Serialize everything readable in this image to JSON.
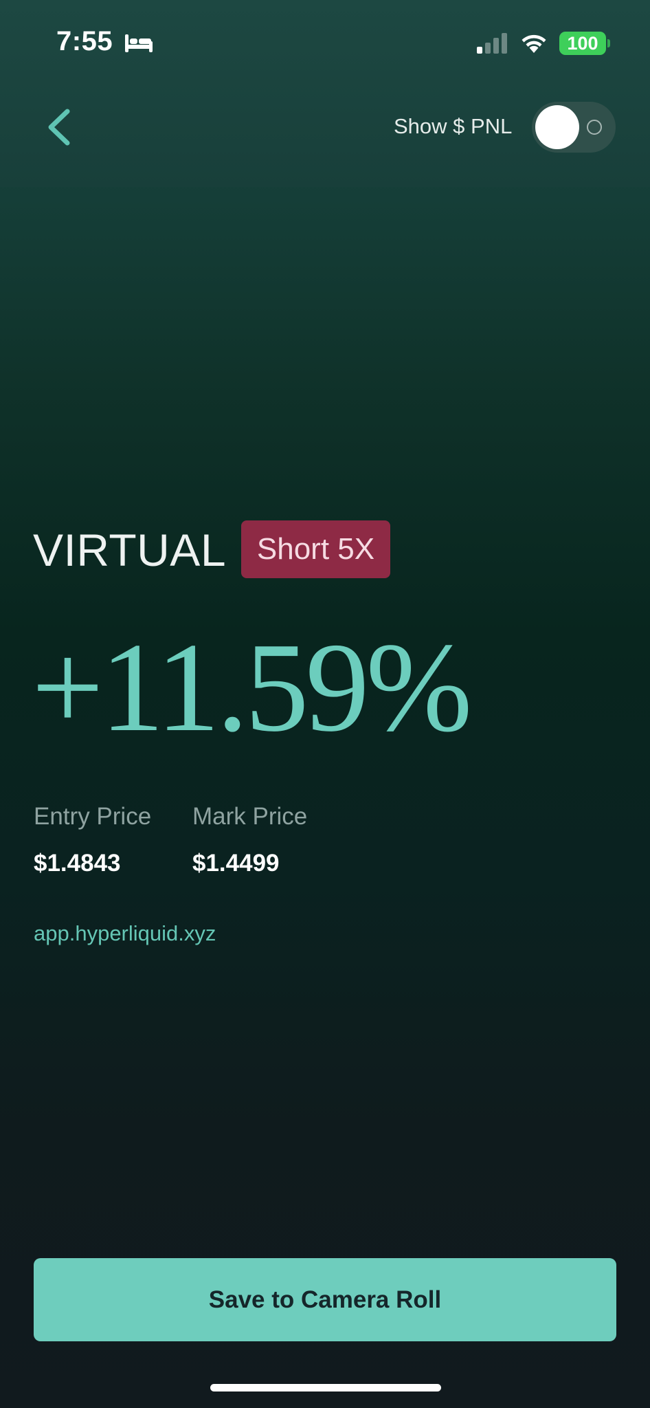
{
  "status_bar": {
    "time": "7:55",
    "battery": "100",
    "icons": [
      "bed-icon",
      "cellular-signal-icon",
      "wifi-icon",
      "battery-icon"
    ]
  },
  "header": {
    "back_icon": "chevron-left-icon",
    "toggle_label": "Show $ PNL",
    "toggle_on": false
  },
  "position": {
    "ticker": "VIRTUAL",
    "badge": "Short 5X",
    "pnl_percent": "+11.59%",
    "entry_label": "Entry Price",
    "entry_value": "$1.4843",
    "mark_label": "Mark Price",
    "mark_value": "$1.4499",
    "url": "app.hyperliquid.xyz"
  },
  "actions": {
    "save_label": "Save to Camera Roll"
  },
  "colors": {
    "accent": "#6ecdbd",
    "badge_bg": "#8e2a45",
    "badge_text": "#f6dbe3",
    "battery": "#3ecf5a"
  }
}
